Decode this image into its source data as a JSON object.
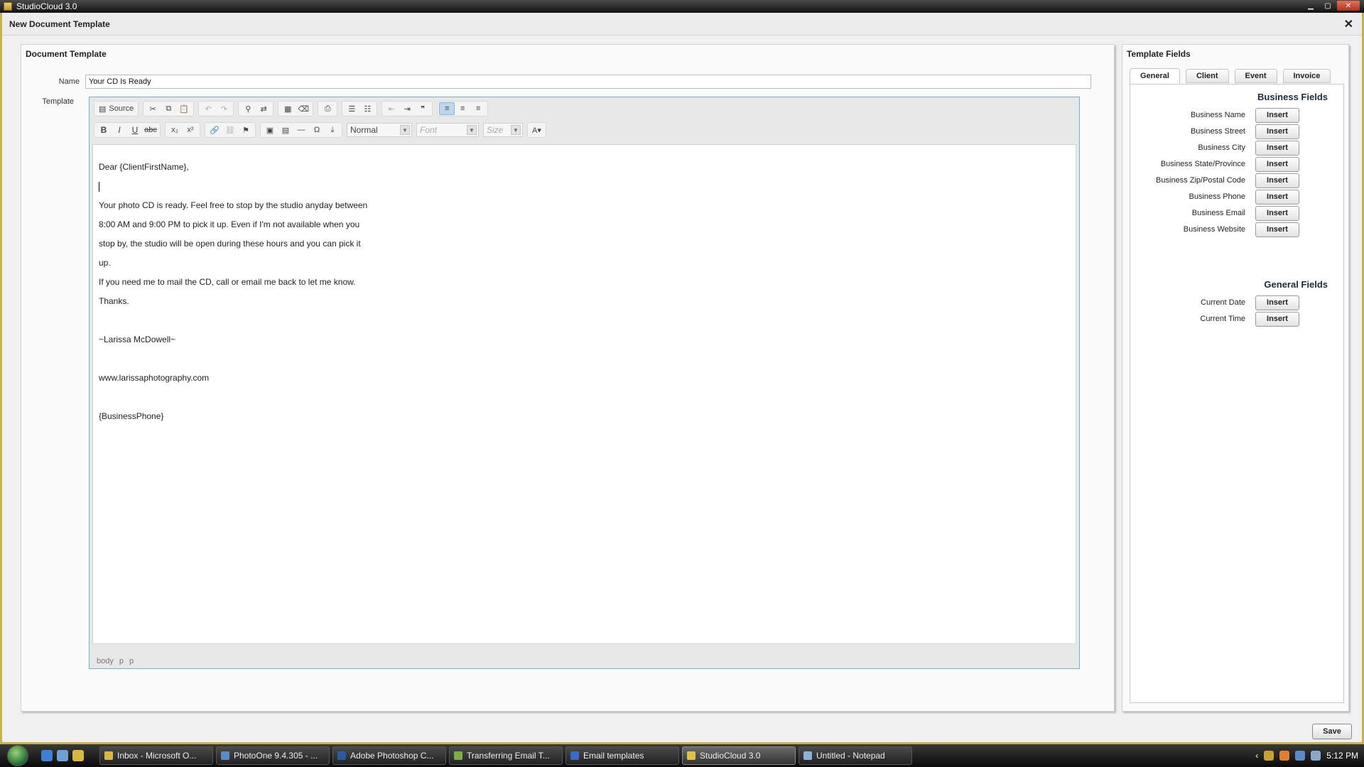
{
  "window": {
    "title": "StudioCloud 3.0"
  },
  "dialog": {
    "title": "New Document Template",
    "close": "✕"
  },
  "document_template": {
    "heading": "Document Template",
    "name_label": "Name",
    "name_value": "Your CD Is Ready",
    "template_label": "Template"
  },
  "editor": {
    "source_label": "Source",
    "format_combo": "Normal",
    "font_combo": "Font",
    "size_combo": "Size",
    "body_lines": [
      " Dear {ClientFirstName},",
      "",
      "Your photo CD is ready. Feel free to stop by the studio anyday between",
      "8:00 AM and 9:00 PM to pick it up. Even if I'm not available when you",
      "stop by, the studio will be open during these hours and you can pick it",
      "up.",
      "If you need me to mail the CD, call or email me back to let me know.",
      "Thanks.",
      "",
      "~Larissa McDowell~",
      "",
      "www.larissaphotography.com",
      "",
      "{BusinessPhone}"
    ],
    "status_path": [
      "body",
      "p",
      "p"
    ]
  },
  "template_fields": {
    "heading": "Template Fields",
    "tabs": [
      "General",
      "Client",
      "Event",
      "Invoice"
    ],
    "active_tab": "General",
    "insert_label": "Insert",
    "business_section": "Business Fields",
    "business_fields": [
      "Business Name",
      "Business Street",
      "Business City",
      "Business State/Province",
      "Business Zip/Postal Code",
      "Business Phone",
      "Business Email",
      "Business Website"
    ],
    "general_section": "General Fields",
    "general_fields": [
      "Current Date",
      "Current Time"
    ]
  },
  "save_label": "Save",
  "taskbar": {
    "items": [
      "Inbox - Microsoft O...",
      "PhotoOne 9.4.305 - ...",
      "Adobe Photoshop C...",
      "Transferring Email T...",
      "Email templates",
      "StudioCloud 3.0",
      "Untitled - Notepad"
    ],
    "active": "StudioCloud 3.0",
    "clock": "5:12 PM"
  },
  "colors": {
    "accent": "#6fb0d8",
    "frame": "#c8b24a"
  }
}
